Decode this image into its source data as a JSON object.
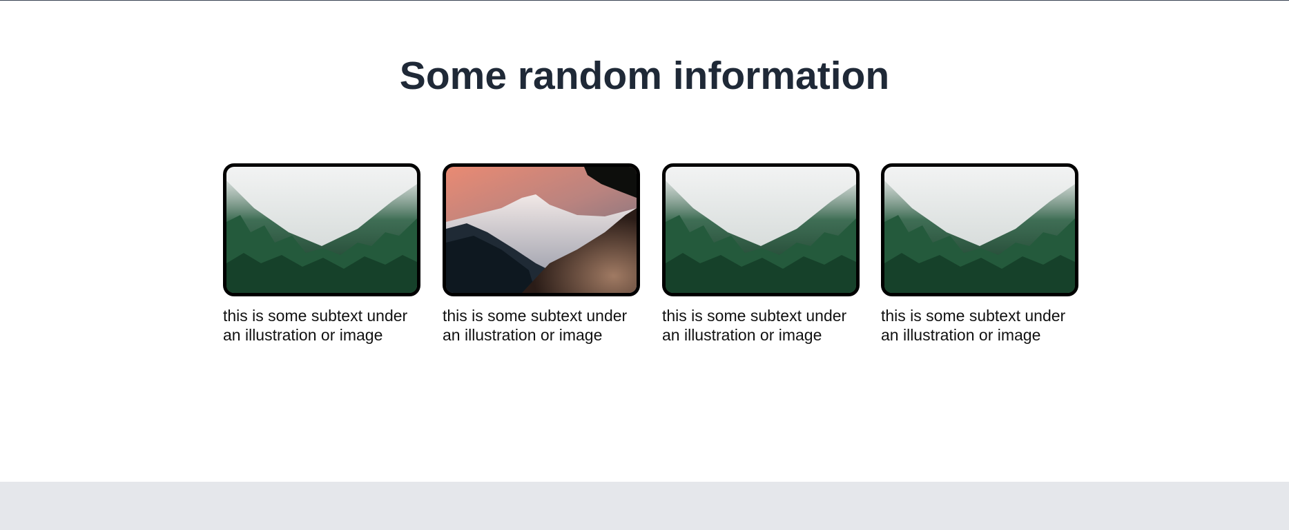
{
  "section": {
    "heading": "Some random information"
  },
  "cards": [
    {
      "image": "misty-forest-photo",
      "caption": "this is some subtext under an illustration or image"
    },
    {
      "image": "mountain-sunset-photo",
      "caption": "this is some subtext under an illustration or image"
    },
    {
      "image": "misty-forest-photo",
      "caption": "this is some subtext under an illustration or image"
    },
    {
      "image": "misty-forest-photo",
      "caption": "this is some subtext under an illustration or image"
    }
  ],
  "colors": {
    "heading": "#1f2937",
    "card_border": "#000000",
    "footer_bg": "#e5e7eb"
  }
}
